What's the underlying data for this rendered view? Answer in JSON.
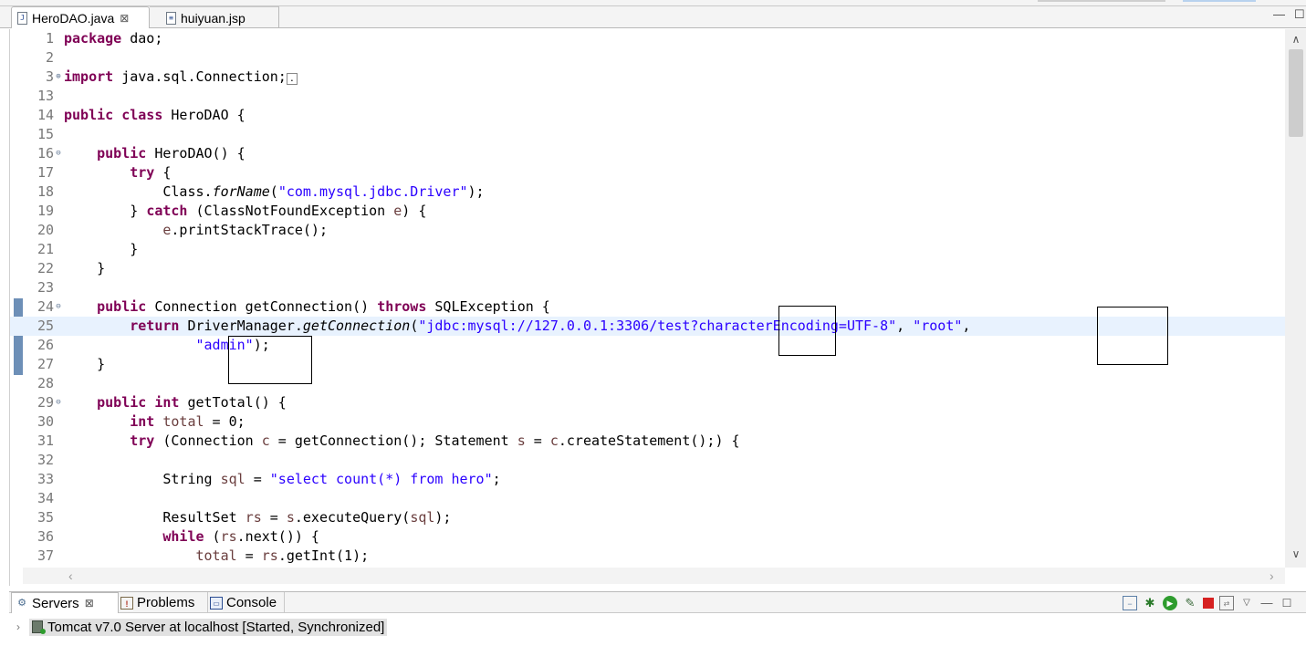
{
  "editor_tabs": [
    {
      "label": "HeroDAO.java",
      "active": true,
      "icon": "java-file-icon",
      "close": "⊠"
    },
    {
      "label": "huiyuan.jsp",
      "active": false,
      "icon": "jsp-file-icon"
    }
  ],
  "code_lines": [
    {
      "n": "1",
      "fold": "",
      "html": "<span class='kw'>package</span> dao;"
    },
    {
      "n": "2",
      "fold": "",
      "html": ""
    },
    {
      "n": "3",
      "fold": "⊕",
      "html": "<span class='kw'>import</span> java.sql.Connection;<span style='border:1px solid #888;font-size:10px;padding:0 2px;'>.</span>"
    },
    {
      "n": "13",
      "fold": "",
      "html": ""
    },
    {
      "n": "14",
      "fold": "",
      "html": "<span class='kw'>public</span> <span class='kw'>class</span> HeroDAO {"
    },
    {
      "n": "15",
      "fold": "",
      "html": ""
    },
    {
      "n": "16",
      "fold": "⊖",
      "html": "    <span class='kw'>public</span> HeroDAO() {"
    },
    {
      "n": "17",
      "fold": "",
      "html": "        <span class='kw'>try</span> {"
    },
    {
      "n": "18",
      "fold": "",
      "html": "            Class.<span class='ital'>forName</span>(<span class='str'>\"com.mysql.jdbc.Driver\"</span>);"
    },
    {
      "n": "19",
      "fold": "",
      "html": "        } <span class='kw'>catch</span> (ClassNotFoundException <span class='var'>e</span>) {"
    },
    {
      "n": "20",
      "fold": "",
      "html": "            <span class='var'>e</span>.printStackTrace();"
    },
    {
      "n": "21",
      "fold": "",
      "html": "        }"
    },
    {
      "n": "22",
      "fold": "",
      "html": "    }"
    },
    {
      "n": "23",
      "fold": "",
      "html": ""
    },
    {
      "n": "24",
      "fold": "⊖",
      "html": "    <span class='kw'>public</span> Connection getConnection() <span class='kw'>throws</span> SQLException {"
    },
    {
      "n": "25",
      "fold": "",
      "current": true,
      "html": "        <span class='kw'>return</span> DriverManager.<span class='ital'>getConnection</span>(<span class='str'>\"jdbc:mysql://127.0.0.1:3306/test?characterEncoding=UTF-8\"</span>, <span class='str'>\"root\"</span>,"
    },
    {
      "n": "26",
      "fold": "",
      "html": "                <span class='str'>\"admin\"</span>);"
    },
    {
      "n": "27",
      "fold": "",
      "html": "    }"
    },
    {
      "n": "28",
      "fold": "",
      "html": ""
    },
    {
      "n": "29",
      "fold": "⊖",
      "html": "    <span class='kw'>public</span> <span class='kw'>int</span> getTotal() {"
    },
    {
      "n": "30",
      "fold": "",
      "html": "        <span class='kw'>int</span> <span class='var'>total</span> = 0;"
    },
    {
      "n": "31",
      "fold": "",
      "html": "        <span class='kw'>try</span> (Connection <span class='var'>c</span> = getConnection(); Statement <span class='var'>s</span> = <span class='var'>c</span>.createStatement();) {"
    },
    {
      "n": "32",
      "fold": "",
      "html": ""
    },
    {
      "n": "33",
      "fold": "",
      "html": "            String <span class='var'>sql</span> = <span class='str'>\"select count(*) from hero\"</span>;"
    },
    {
      "n": "34",
      "fold": "",
      "html": ""
    },
    {
      "n": "35",
      "fold": "",
      "html": "            ResultSet <span class='var'>rs</span> = <span class='var'>s</span>.executeQuery(<span class='var'>sql</span>);"
    },
    {
      "n": "36",
      "fold": "",
      "html": "            <span class='kw'>while</span> (<span class='var'>rs</span>.next()) {"
    },
    {
      "n": "37",
      "fold": "",
      "html": "                <span class='var'>total</span> = <span class='var'>rs</span>.getInt(1);"
    }
  ],
  "panel_tabs": [
    {
      "label": "Servers",
      "active": true,
      "close": "⊠"
    },
    {
      "label": "Problems",
      "active": false
    },
    {
      "label": "Console",
      "active": false
    }
  ],
  "servers": [
    {
      "label": "Tomcat v7.0 Server at localhost  [Started, Synchronized]"
    }
  ],
  "colors": {
    "keyword": "#7f0055",
    "string": "#2a00ff",
    "line_highlight": "#e8f2fe"
  }
}
